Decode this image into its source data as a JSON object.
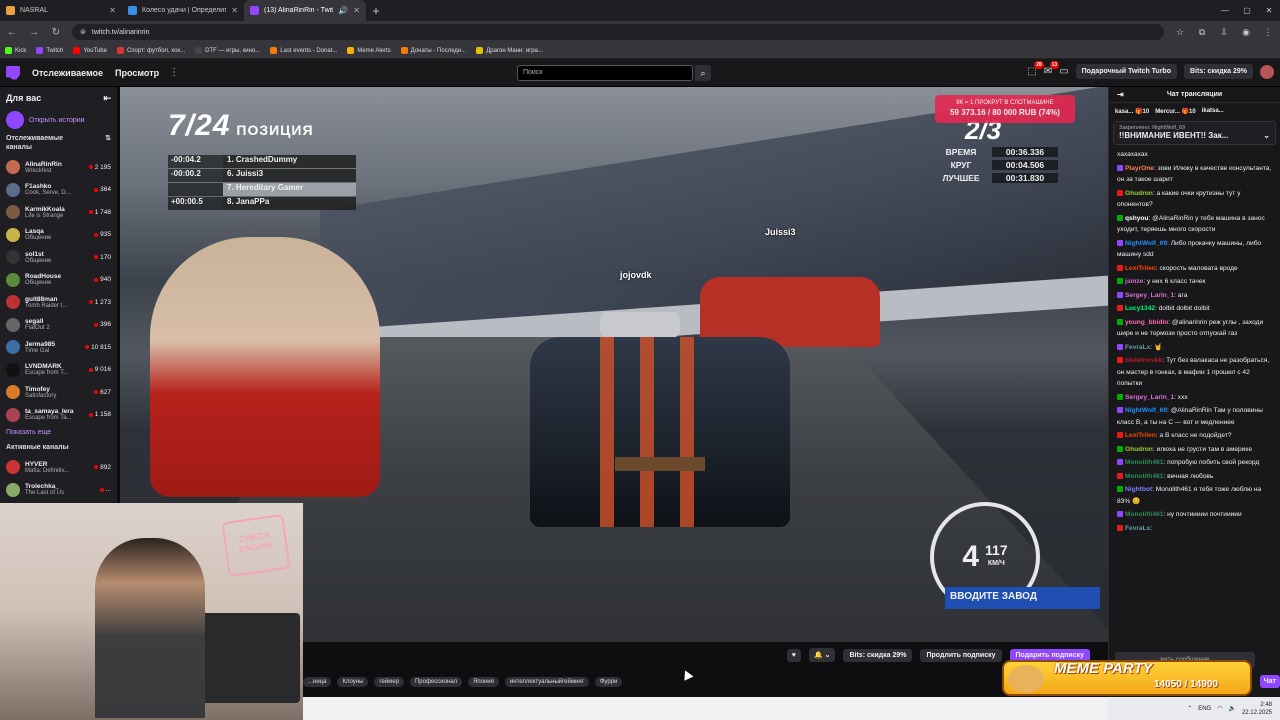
{
  "browser": {
    "tabs": [
      {
        "title": "NASRAL",
        "color": "#e8a33d"
      },
      {
        "title": "Колесо удачи | Определите ...",
        "color": "#3a8ee6"
      },
      {
        "title": "(13) AlinaRinRin - Twitch",
        "color": "#9147ff"
      }
    ],
    "url": "twitch.tv/alinarinrin",
    "bookmarks": [
      {
        "label": "Kick",
        "color": "#53fc18"
      },
      {
        "label": "Twitch",
        "color": "#9147ff"
      },
      {
        "label": "YouTube",
        "color": "#ff0000"
      },
      {
        "label": "Спорт: футбол, хок...",
        "color": "#d33"
      },
      {
        "label": "DTF — игры, кино...",
        "color": "#444"
      },
      {
        "label": "Last events - Donat...",
        "color": "#f57d07"
      },
      {
        "label": "Meme Alerts",
        "color": "#f5b400"
      },
      {
        "label": "Донаты - Последн...",
        "color": "#f57d07"
      },
      {
        "label": "Драгон Мани: игра...",
        "color": "#e5c100"
      }
    ]
  },
  "topnav": {
    "following": "Отслеживаемое",
    "browse": "Просмотр",
    "search_placeholder": "Поиск",
    "notif_count_1": "28",
    "notif_count_2": "13",
    "turbo": "Подарочный Twitch Turbo",
    "bits": "Bits: скидка 29%"
  },
  "sidebar": {
    "title": "Для вас",
    "stories": "Открыть истории",
    "followed_title": "Отслеживаемые каналы",
    "channels": [
      {
        "name": "AlinaRinRin",
        "game": "Wreckfest",
        "viewers": "2 195",
        "color": "#c46a4f"
      },
      {
        "name": "F1ashko",
        "game": "Cook, Serve, D...",
        "viewers": "364",
        "color": "#5a6e8c"
      },
      {
        "name": "KarmikKoala",
        "game": "Life is Strange",
        "viewers": "1 748",
        "color": "#7a5b42"
      },
      {
        "name": "Lasqa",
        "game": "Общение",
        "viewers": "935",
        "color": "#c9b44a"
      },
      {
        "name": "sol1st",
        "game": "Общение",
        "viewers": "170",
        "color": "#333"
      },
      {
        "name": "RoadHouse",
        "game": "Общение",
        "viewers": "940",
        "color": "#5c8a3c"
      },
      {
        "name": "guit88man",
        "game": "Tomb Raider I...",
        "viewers": "1 273",
        "color": "#b33"
      },
      {
        "name": "segall",
        "game": "FlatOut 2",
        "viewers": "396",
        "color": "#666"
      },
      {
        "name": "Jerma985",
        "game": "Time Gal",
        "viewers": "10 815",
        "color": "#3a6ea5"
      },
      {
        "name": "LVNDMARK",
        "game": "Escape from T...",
        "viewers": "9 016",
        "color": "#111"
      },
      {
        "name": "Timofey",
        "game": "Satisfactory",
        "viewers": "627",
        "color": "#d87a2a"
      },
      {
        "name": "ta_samaya_lera",
        "game": "Escape from Ta...",
        "viewers": "1 158",
        "color": "#a45"
      }
    ],
    "show_more": "Показать еще",
    "active_title": "Активные каналы",
    "active": [
      {
        "name": "HYVER",
        "game": "Mafia: Definitiv...",
        "viewers": "892",
        "color": "#c33"
      },
      {
        "name": "Trolechka_",
        "game": "The Last of Us",
        "viewers": "...",
        "color": "#8a6"
      }
    ]
  },
  "game": {
    "position": "7/24",
    "position_label": "ПОЗИЦИЯ",
    "leaderboard": [
      {
        "gap": "-00:04.2",
        "place": "1.",
        "name": "CrashedDummy"
      },
      {
        "gap": "-00:00.2",
        "place": "6.",
        "name": "Juissi3"
      },
      {
        "gap": "",
        "place": "7.",
        "name": "Hereditary Gamer"
      },
      {
        "gap": "+00:00.5",
        "place": "8.",
        "name": "JanaPPa"
      }
    ],
    "lap": "2/3",
    "race_info": [
      {
        "key": "ВРЕМЯ",
        "value": "00:36.336"
      },
      {
        "key": "КРУГ",
        "value": "00:04.506"
      },
      {
        "key": "ЛУЧШЕЕ",
        "value": "00:31.830"
      }
    ],
    "donation_line1": "8К = 1 ПРОКРУТ В СЛОТМАШИНЕ",
    "donation_line2": "59 373.16 / 80 000 RUB (74%)",
    "donation_progress": 0.74,
    "rival_tag_1": "Juissi3",
    "rival_tag_2": "jojovdk",
    "gear": "4",
    "speed": "117",
    "speed_unit": "КМ/Ч",
    "banner": "ВВОДИТЕ ЗАВОД"
  },
  "webcam": {
    "sign": "CHECK ENGINE"
  },
  "controls": {
    "bits": "Bits: скидка 29%",
    "extend": "Продлить подписку",
    "gift": "Подарить подписку"
  },
  "tags": [
    "...ница",
    "Клоуны",
    "геймер",
    "Профессионал",
    "Япония",
    "интеллектуальныйгейминг",
    "Фурри"
  ],
  "chat": {
    "title": "Чат трансляции",
    "gifters": [
      {
        "name": "kasa...",
        "count": "10"
      },
      {
        "name": "Mercur...",
        "count": "10"
      },
      {
        "name": "ikatsa...",
        "count": ""
      }
    ],
    "pinned_by": "Закреплено: NightWolf_69",
    "pinned_text": "!!ВНИМАНИЕ ИВЕНТ!! Зак...",
    "messages": [
      {
        "user": "",
        "color": "#efeff1",
        "text": "хахахахах"
      },
      {
        "user": "PlayrOne",
        "color": "#ff7f50",
        "text": "зови Илюку в качестве консультанта, он за такое шарит"
      },
      {
        "user": "Ghudron",
        "color": "#9acd32",
        "text": "а какие очки крутизны тут у опонентов?"
      },
      {
        "user": "qshyou",
        "color": "#ffffff",
        "text": "@AlinaRinRin у тебя машина в занос уходит, теряешь много скорости"
      },
      {
        "user": "NightWolf_69",
        "color": "#1e90ff",
        "text": "Либо прокачку машины, либо машину sdd"
      },
      {
        "user": "LexiTrilen",
        "color": "#ff4500",
        "text": "скорость маловата вроде"
      },
      {
        "user": "jsinze",
        "color": "#da70d6",
        "text": "у них 6 класс тачек"
      },
      {
        "user": "Sergey_Larin_1",
        "color": "#da70d6",
        "text": "ага"
      },
      {
        "user": "Lucy1342",
        "color": "#00ff7f",
        "text": "dolbit dolbit dolbit"
      },
      {
        "user": "young_bbidlo",
        "color": "#ff69b4",
        "text": "@alinarinrin реж углы , заходи шире и не тормози просто отпускай газ"
      },
      {
        "user": "FevraLx",
        "color": "#5f9ea0",
        "text": "🤘"
      },
      {
        "user": "Skiletron4ik",
        "color": "#b22222",
        "text": "Тут без валакаса не разобраться, он мастер в гонках, в мафии 1 прошел с 42 попытки"
      },
      {
        "user": "Sergey_Larin_1",
        "color": "#da70d6",
        "text": "ххх"
      },
      {
        "user": "NightWolf_69",
        "color": "#1e90ff",
        "text": "@AlinaRinRin Там у половины класс B, а ты на C — вот и медленнее"
      },
      {
        "user": "LexiTrilen",
        "color": "#ff4500",
        "text": "а B класс не подойдет?"
      },
      {
        "user": "Ghudron",
        "color": "#9acd32",
        "text": "илюха не грусти там в америке"
      },
      {
        "user": "Monolith461",
        "color": "#2e8b57",
        "text": "попробую побить свой рекорд"
      },
      {
        "user": "Monolith461",
        "color": "#2e8b57",
        "text": "вечная любовь"
      },
      {
        "user": "Nightbot",
        "color": "#7c7cff",
        "text": "Monolith461 я тебя тоже люблю на 83% 😊"
      },
      {
        "user": "Monolith461",
        "color": "#2e8b57",
        "text": "ну почтиииии почтиииии"
      },
      {
        "user": "FevraLx",
        "color": "#5f9ea0",
        "text": ""
      }
    ],
    "input_placeholder": "...вить сообщение",
    "send": "Чат"
  },
  "meme_party": {
    "title": "MEME PARTY",
    "progress_text": "14050 / 14900",
    "progress": 0.943
  },
  "taskbar": {
    "lang": "ENG",
    "time": "2:48",
    "date": "22.12.2025"
  }
}
